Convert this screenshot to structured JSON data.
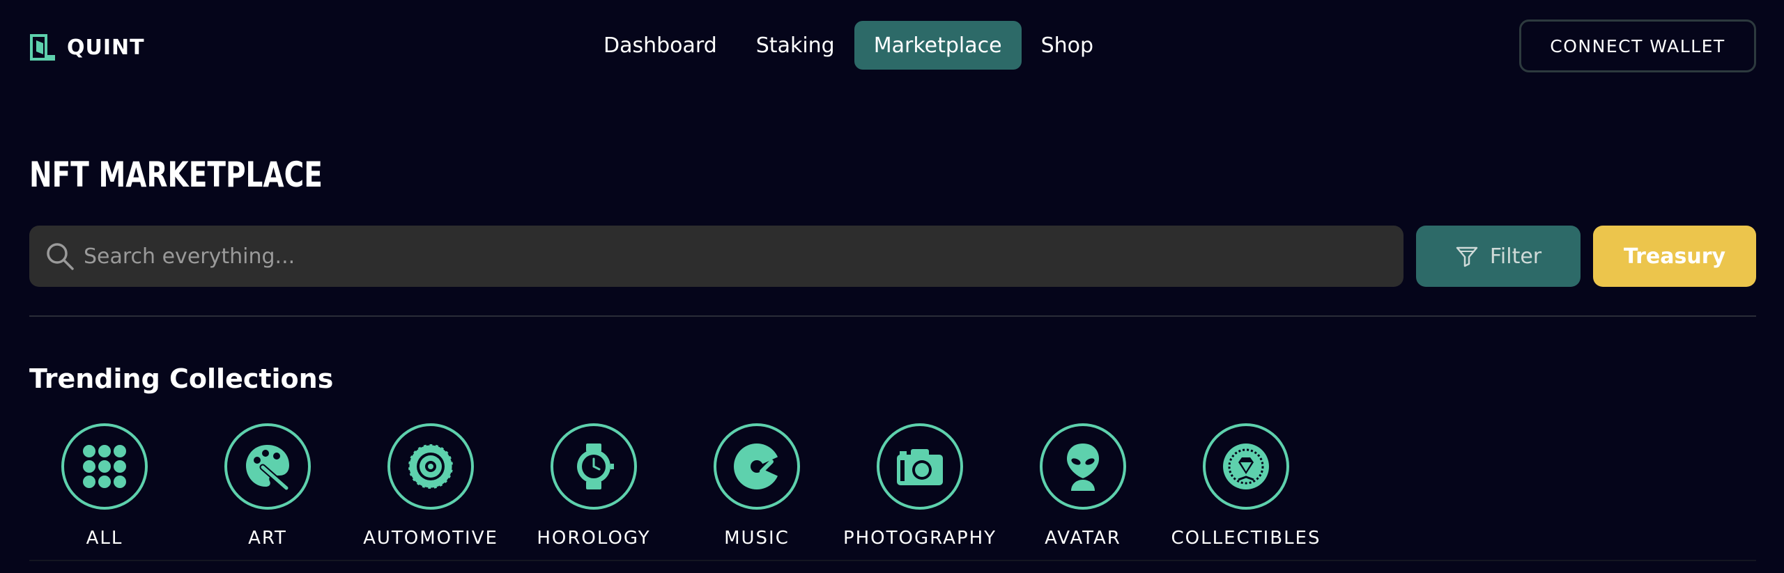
{
  "app": {
    "logo_text": "QUINT"
  },
  "nav": {
    "items": [
      {
        "label": "Dashboard",
        "active": false
      },
      {
        "label": "Staking",
        "active": false
      },
      {
        "label": "Marketplace",
        "active": true
      },
      {
        "label": "Shop",
        "active": false
      }
    ]
  },
  "header": {
    "connect_label": "CONNECT WALLET"
  },
  "main": {
    "title": "NFT MARKETPLACE",
    "search": {
      "placeholder": "Search everything...",
      "value": ""
    },
    "filter_label": "Filter",
    "treasury_label": "Treasury",
    "section_title": "Trending Collections",
    "categories": [
      {
        "label": "ALL",
        "icon": "grid-icon"
      },
      {
        "label": "ART",
        "icon": "palette-icon"
      },
      {
        "label": "AUTOMOTIVE",
        "icon": "tire-icon"
      },
      {
        "label": "HOROLOGY",
        "icon": "watch-icon"
      },
      {
        "label": "MUSIC",
        "icon": "music-disc-icon"
      },
      {
        "label": "PHOTOGRAPHY",
        "icon": "camera-icon"
      },
      {
        "label": "AVATAR",
        "icon": "alien-icon"
      },
      {
        "label": "COLLECTIBLES",
        "icon": "diamond-emblem-icon"
      }
    ]
  },
  "colors": {
    "background": "#05051a",
    "accent_teal": "#2d6a68",
    "accent_mint": "#5ed1ad",
    "treasury_yellow": "#ecc54c",
    "search_bg": "#2d2d2d"
  }
}
